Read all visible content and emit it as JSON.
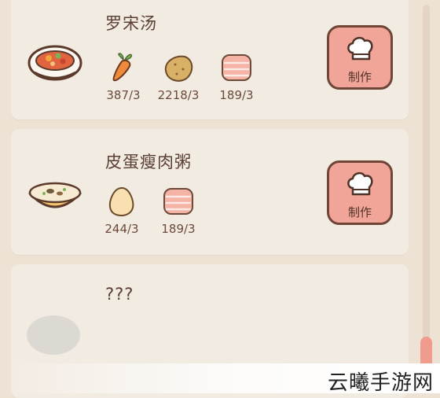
{
  "recipes": [
    {
      "name": "罗宋汤",
      "dish_icon": "borscht-bowl-icon",
      "ingredients": [
        {
          "icon": "carrot-icon",
          "qty": "387/3"
        },
        {
          "icon": "potato-icon",
          "qty": "2218/3"
        },
        {
          "icon": "meat-slice-icon",
          "qty": "189/3"
        }
      ],
      "button": {
        "label": "制作",
        "icon": "chef-hat-icon"
      }
    },
    {
      "name": "皮蛋瘦肉粥",
      "dish_icon": "congee-bowl-icon",
      "ingredients": [
        {
          "icon": "egg-icon",
          "qty": "244/3"
        },
        {
          "icon": "meat-slice-icon",
          "qty": "189/3"
        }
      ],
      "button": {
        "label": "制作",
        "icon": "chef-hat-icon"
      }
    },
    {
      "name": "???",
      "dish_icon": "unknown-dish-icon"
    }
  ],
  "watermark": "云曦手游网",
  "colors": {
    "background": "#ede2d4",
    "card": "#f2ebe2",
    "button": "#f1a598",
    "button_border": "#6e4537",
    "scroll_thumb": "#ef9c8e"
  }
}
